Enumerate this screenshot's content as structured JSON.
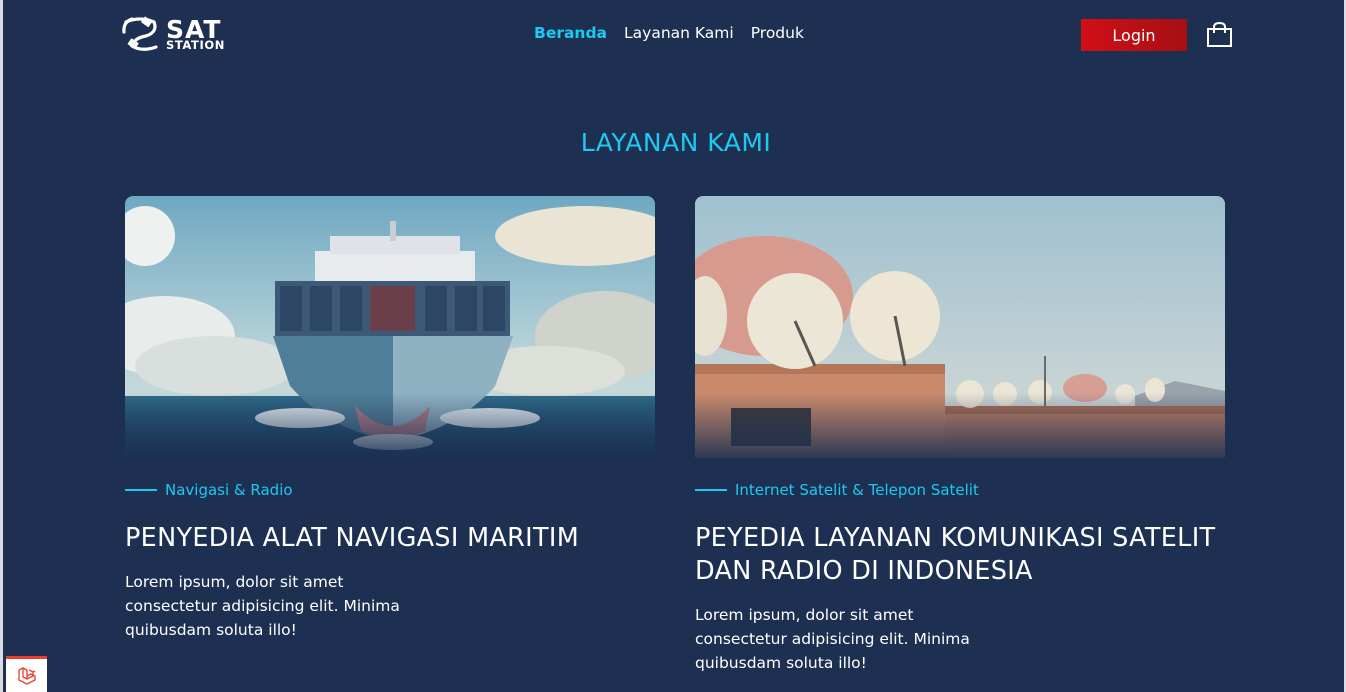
{
  "header": {
    "logo_main": "SAT",
    "logo_sub": "STATION",
    "nav": [
      {
        "label": "Beranda",
        "active": true
      },
      {
        "label": "Layanan Kami",
        "active": false
      },
      {
        "label": "Produk",
        "active": false
      }
    ],
    "login_label": "Login"
  },
  "section": {
    "title": "LAYANAN KAMI"
  },
  "cards": [
    {
      "category": "Navigasi & Radio",
      "title": "PENYEDIA ALAT NAVIGASI MARITIM",
      "description": "Lorem ipsum, dolor sit amet consectetur adipisicing elit. Minima quibusdam soluta illo!"
    },
    {
      "category": "Internet Satelit & Telepon Satelit",
      "title": "PEYEDIA LAYANAN KOMUNIKASI SATELIT DAN RADIO DI INDONESIA",
      "description": "Lorem ipsum, dolor sit amet consectetur adipisicing elit. Minima quibusdam soluta illo!"
    }
  ],
  "colors": {
    "background": "#1d3052",
    "accent": "#1ec8f0",
    "login": "#c8101a"
  }
}
